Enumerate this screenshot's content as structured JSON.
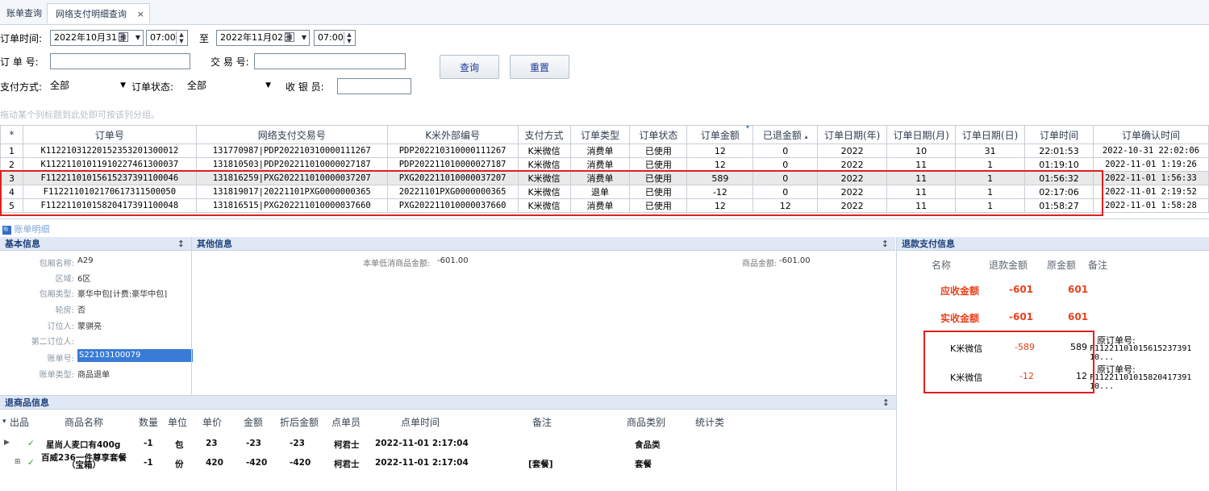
{
  "tabs": {
    "inactive": "账单查询",
    "active": "网络支付明细查询",
    "close": "×"
  },
  "form": {
    "order_time_label": "订单时间:",
    "start_date": "2022年10月31日",
    "start_time": "07:00",
    "to_label": "至",
    "end_date": "2022年11月02日",
    "end_time": "07:00",
    "order_no_label": "订 单 号:",
    "order_no_value": "",
    "trade_no_label": "交 易 号:",
    "trade_no_value": "",
    "pay_method_label": "支付方式:",
    "pay_method_value": "全部",
    "order_status_label": "订单状态:",
    "order_status_value": "全部",
    "cashier_label": "收 银 员:",
    "cashier_value": "",
    "query_button": "查询",
    "reset_button": "重置"
  },
  "group_hint": "拖动某个列标题到此处即可按该列分组。",
  "grid": {
    "columns": [
      "*",
      "订单号",
      "网络支付交易号",
      "K米外部编号",
      "支付方式",
      "订单类型",
      "订单状态",
      "订单金额",
      "已退金额",
      "订单日期(年)",
      "订单日期(月)",
      "订单日期(日)",
      "订单时间",
      "订单确认时间"
    ],
    "sort_marks": {
      "amount": "▾",
      "refund": "▴"
    },
    "rows": [
      [
        "1",
        "K112210312201523532013000​12",
        "131770987|PDP20221031000011126​7",
        "PDP20221031000011126​7",
        "K米微信",
        "消费单",
        "已使用",
        "12",
        "0",
        "2022",
        "10",
        "31",
        "22:01:53",
        "2022-10-31 22:02:06"
      ],
      [
        "2",
        "K11221101011910227461300037",
        "131810503|PDP202211010000027187",
        "PDP202211010000027187",
        "K米微信",
        "消费单",
        "已使用",
        "12",
        "0",
        "2022",
        "11",
        "1",
        "01:19:10",
        "2022-11-01 1:19:26"
      ],
      [
        "3",
        "F11221101015615237391100046",
        "131816259|PXG202211010000037207",
        "PXG202211010000037207",
        "K米微信",
        "消费单",
        "已使用",
        "589",
        "0",
        "2022",
        "11",
        "1",
        "01:56:32",
        "2022-11-01 1:56:33"
      ],
      [
        "4",
        "F11221101021706173115000​50",
        "131819017|20221101PXG0000000365",
        "20221101PXG0000000365",
        "K米微信",
        "退单",
        "已使用",
        "-12",
        "0",
        "2022",
        "11",
        "1",
        "02:17:06",
        "2022-11-01 2:19:52"
      ],
      [
        "5",
        "F11221101015820417391100048",
        "131816515|PXG202211010000037660",
        "PXG202211010000037660",
        "K米微信",
        "消费单",
        "已使用",
        "12",
        "12",
        "2022",
        "11",
        "1",
        "01:58:27",
        "2022-11-01 1:58:28"
      ]
    ],
    "selected_row": 3
  },
  "detail_title": "账单明细",
  "basic_info": {
    "title": "基本信息",
    "pin": "↕",
    "fields": [
      {
        "label": "包厢名称:",
        "value": "A29"
      },
      {
        "label": "区域:",
        "value": "6区"
      },
      {
        "label": "包厢类型:",
        "value": "豪华中包[计费:豪华中包]"
      },
      {
        "label": "轮房:",
        "value": "否"
      },
      {
        "label": "订位人:",
        "value": "蒙骐亮"
      },
      {
        "label": "第二订位人:",
        "value": ""
      },
      {
        "label": "账单号:",
        "value": "S22103100079"
      },
      {
        "label": "账单类型:",
        "value": "商品退单"
      }
    ]
  },
  "other_info": {
    "title": "其他信息",
    "pin": "↕",
    "min_spend_label": "本单低消商品金额:",
    "min_spend_value": "-601.00",
    "goods_amount_label": "商品金额:",
    "goods_amount_value": "-601.00"
  },
  "refund_info": {
    "title": "退款支付信息",
    "headers": [
      "名称",
      "退款金额",
      "原金额",
      "备注"
    ],
    "summary": [
      {
        "name": "应收金额",
        "refund": "-601",
        "original": "601"
      },
      {
        "name": "实收金额",
        "refund": "-601",
        "original": "601"
      }
    ],
    "items": [
      {
        "name": "K米微信",
        "refund": "-589",
        "original": "589",
        "note_label": "原订单号:",
        "note_value": "F11221101015615237391​10..."
      },
      {
        "name": "K米微信",
        "refund": "-12",
        "original": "12",
        "note_label": "原订单号:",
        "note_value": "F11221101015820417391​10..."
      }
    ]
  },
  "returned_goods": {
    "title": "退商品信息",
    "pin": "↕",
    "headers": [
      "出品",
      "商品名称",
      "数量",
      "单位",
      "单价",
      "金额",
      "折后金额",
      "点单员",
      "点单时间",
      "备注",
      "商品类别",
      "统计类"
    ],
    "rows": [
      {
        "name": "星尚人麦口有400g",
        "qty": "-1",
        "unit": "包",
        "price": "23",
        "amount": "-23",
        "discounted": "-23",
        "clerk": "柯君士",
        "time": "2022-11-01 2:17:04",
        "note": "",
        "category": "食品类"
      },
      {
        "name": "百威236一件尊享套餐（宝箱）",
        "qty": "-1",
        "unit": "份",
        "price": "420",
        "amount": "-420",
        "discounted": "-420",
        "clerk": "柯君士",
        "time": "2022-11-01 2:17:04",
        "note": "[套餐]",
        "category": "套餐"
      }
    ]
  },
  "colors": {
    "accent": "#1e3f78",
    "highlight_box": "#e02020",
    "negative": "#e23b1c"
  }
}
